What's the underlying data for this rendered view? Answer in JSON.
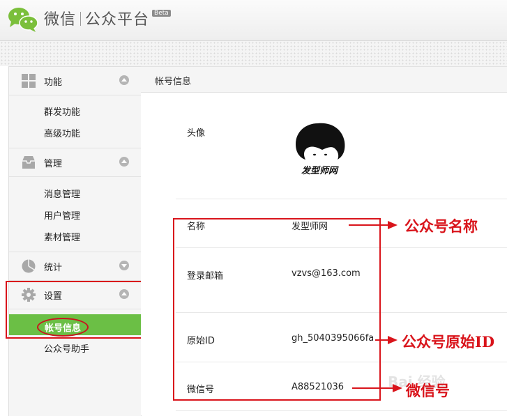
{
  "header": {
    "brand_name": "微信",
    "brand_product": "公众平台",
    "beta_badge": "Beta"
  },
  "sidebar": {
    "sections": [
      {
        "label": "功能",
        "icon": "grid-icon",
        "items": [
          "群发功能",
          "高级功能"
        ]
      },
      {
        "label": "管理",
        "icon": "inbox-icon",
        "items": [
          "消息管理",
          "用户管理",
          "素材管理"
        ]
      },
      {
        "label": "统计",
        "icon": "pie-chart-icon",
        "items": []
      },
      {
        "label": "设置",
        "icon": "gear-icon",
        "items": [
          "帐号信息",
          "公众号助手"
        ]
      }
    ],
    "active_item": "帐号信息"
  },
  "main": {
    "title": "帐号信息",
    "avatar_label": "头像",
    "avatar_caption": "发型师网",
    "rows": [
      {
        "label": "名称",
        "value": "发型师网"
      },
      {
        "label": "登录邮箱",
        "value": "vzvs@163.com"
      },
      {
        "label": "原始ID",
        "value": "gh_5040395066fa"
      },
      {
        "label": "微信号",
        "value": "A88521036"
      }
    ]
  },
  "annotations": {
    "name_label": "公众号名称",
    "original_id_label": "公众号原始ID",
    "wechat_id_label": "微信号"
  },
  "watermark": "Bai 经验",
  "colors": {
    "accent_green": "#6bbf45",
    "annotation_red": "#d9141b"
  }
}
